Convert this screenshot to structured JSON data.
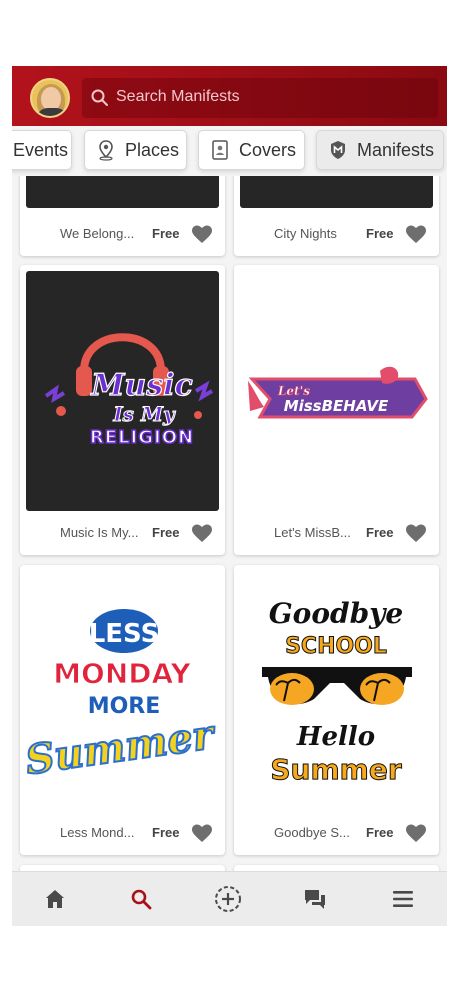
{
  "search": {
    "placeholder": "Search Manifests"
  },
  "tabs": [
    {
      "label": "Events",
      "icon": "events-icon"
    },
    {
      "label": "Places",
      "icon": "map-pin-icon"
    },
    {
      "label": "Covers",
      "icon": "cover-icon"
    },
    {
      "label": "Manifests",
      "icon": "manifest-badge-icon",
      "active": true
    }
  ],
  "cards": [
    {
      "title": "We Belong...",
      "price": "Free"
    },
    {
      "title": "City Nights",
      "price": "Free"
    },
    {
      "title": "Music Is My...",
      "price": "Free",
      "art": {
        "line1": "Music",
        "line2": "Is My",
        "line3": "RELIGION"
      }
    },
    {
      "title": "Let's MissB...",
      "price": "Free",
      "art": {
        "line1": "Let's",
        "line2": "MissBEHAVE"
      }
    },
    {
      "title": "Less Mond...",
      "price": "Free",
      "art": {
        "line1": "LESS",
        "line2": "MONDAY",
        "line3": "MORE",
        "line4": "Summer"
      }
    },
    {
      "title": "Goodbye S...",
      "price": "Free",
      "art": {
        "line1": "Goodbye",
        "line2": "SCHOOL",
        "line3": "Hello",
        "line4": "Summer"
      }
    }
  ],
  "bottom_nav": [
    "home-icon",
    "search-icon",
    "add-icon",
    "chat-icon",
    "menu-icon"
  ],
  "colors": {
    "brand": "#a80f19",
    "heart": "#6e6e6e"
  }
}
